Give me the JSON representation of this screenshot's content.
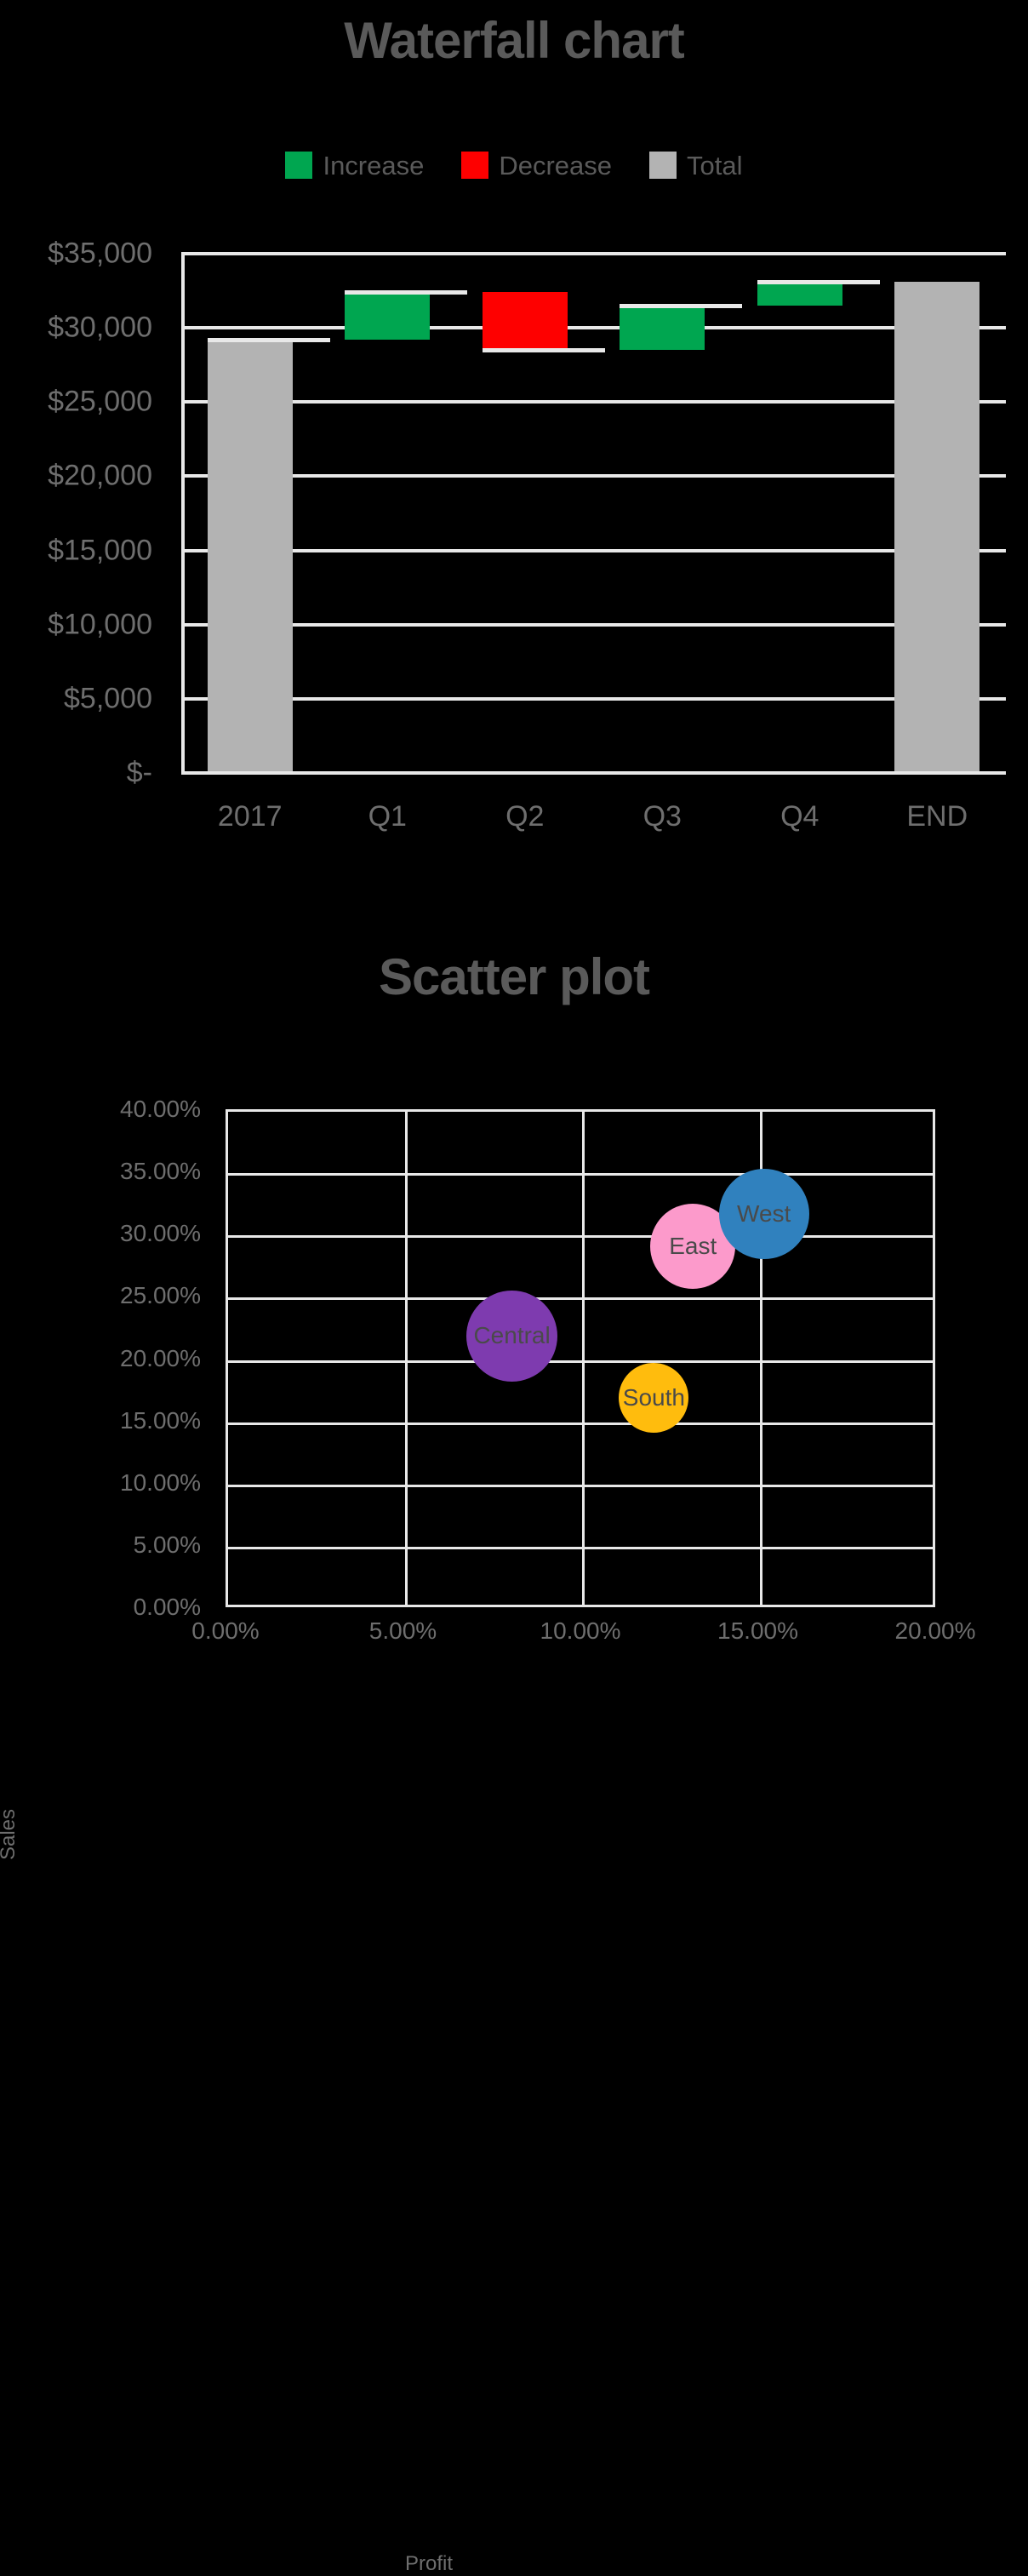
{
  "waterfall": {
    "title": "Waterfall chart",
    "legend": [
      {
        "label": "Increase",
        "color": "#00A650"
      },
      {
        "label": "Decrease",
        "color": "#FE0000"
      },
      {
        "label": "Total",
        "color": "#B3B3B3"
      }
    ],
    "y_tick_labels": [
      "$35,000",
      "$30,000",
      "$25,000",
      "$20,000",
      "$15,000",
      "$10,000",
      "$5,000",
      "$-"
    ],
    "x_tick_labels": [
      "2017",
      "Q1",
      "Q2",
      "Q3",
      "Q4",
      "END"
    ]
  },
  "scatter": {
    "title": "Scatter plot",
    "xlabel": "Profit",
    "ylabel": "Sales",
    "y_tick_labels": [
      "40.00%",
      "35.00%",
      "30.00%",
      "25.00%",
      "20.00%",
      "15.00%",
      "10.00%",
      "5.00%",
      "0.00%"
    ],
    "x_tick_labels": [
      "0.00%",
      "5.00%",
      "10.00%",
      "15.00%",
      "20.00%"
    ]
  },
  "chart_data": [
    {
      "type": "bar",
      "subtype": "waterfall",
      "title": "Waterfall chart",
      "xlabel": "",
      "ylabel": "",
      "ylim": [
        0,
        35000
      ],
      "ytick_step": 5000,
      "grid": true,
      "legend_position": "top-center",
      "legend": [
        "Increase",
        "Decrease",
        "Total"
      ],
      "categories": [
        "2017",
        "Q1",
        "Q2",
        "Q3",
        "Q4",
        "END"
      ],
      "kinds": [
        "total",
        "increase",
        "decrease",
        "increase",
        "increase",
        "total"
      ],
      "base": [
        0,
        29200,
        28500,
        28500,
        31500,
        0
      ],
      "top": [
        29200,
        32400,
        32400,
        31500,
        33100,
        33100
      ],
      "deltas": [
        29200,
        3200,
        -3900,
        3000,
        1600,
        33100
      ],
      "cumulative": [
        29200,
        32400,
        28500,
        31500,
        33100,
        33100
      ],
      "colors": {
        "increase": "#00A650",
        "decrease": "#FE0000",
        "total": "#B3B3B3"
      }
    },
    {
      "type": "scatter",
      "subtype": "bubble",
      "title": "Scatter plot",
      "xlabel": "Profit",
      "ylabel": "Sales",
      "xlim": [
        0,
        20
      ],
      "ylim": [
        0,
        40
      ],
      "xtick_step": 5,
      "ytick_step": 5,
      "xtick_format": "percent",
      "ytick_format": "percent",
      "grid": true,
      "points": [
        {
          "label": "Central",
          "x": 8.0,
          "y": 22.0,
          "size": 107,
          "color": "#7E3BAF"
        },
        {
          "label": "South",
          "x": 12.0,
          "y": 17.0,
          "size": 82,
          "color": "#FFBC0D"
        },
        {
          "label": "East",
          "x": 13.1,
          "y": 29.2,
          "size": 100,
          "color": "#FC9ACB"
        },
        {
          "label": "West",
          "x": 15.1,
          "y": 31.8,
          "size": 106,
          "color": "#3081BE"
        }
      ]
    }
  ]
}
